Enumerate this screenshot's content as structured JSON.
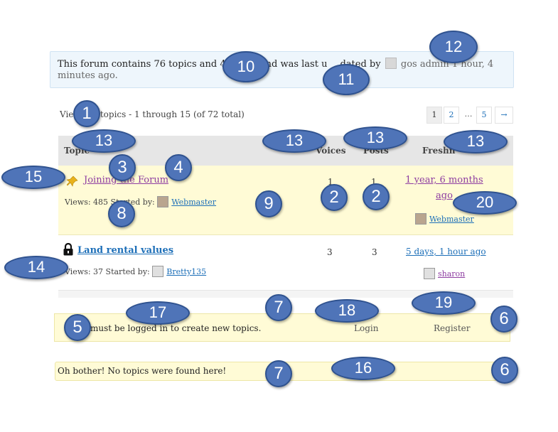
{
  "info": {
    "text_a": "This forum contains 76 topics and 4",
    "text_b": ", and was last u",
    "text_c": "dated by",
    "user": "gos admin",
    "time_a": "1 hour, 4",
    "time_b": "minutes ago."
  },
  "viewing": {
    "text_a": "Vie",
    "text_b": "6 topics - 1 through 15 (of 72 total)"
  },
  "pagination": {
    "pages": [
      "1",
      "2",
      "…",
      "5"
    ],
    "next": "→"
  },
  "table": {
    "headers": {
      "topic": "Topic",
      "voices": "Voices",
      "posts": "Posts",
      "freshness": "Freshn"
    },
    "rows": [
      {
        "title": "Joining the Forum",
        "views": "Views: 485",
        "started_by_label": "Started by:",
        "author": "Webmaster",
        "voices": "1",
        "posts": "1",
        "fresh_a": "1 year, 6 months",
        "fresh_b": "ago",
        "fresh_user": "Webmaster"
      },
      {
        "title": "Land rental values",
        "views": "Views: 37",
        "started_by_label": "Started by:",
        "author": "Bretty135",
        "voices": "3",
        "posts": "3",
        "fresh_a": "5 days, 1 hour ago",
        "fresh_user": "sharon"
      }
    ]
  },
  "notice": {
    "text": "must be logged in to create new topics.",
    "login": "Login",
    "register": "Register"
  },
  "empty": {
    "text": "Oh bother! No topics were found here!"
  },
  "callouts": [
    "1",
    "2",
    "2",
    "3",
    "4",
    "5",
    "6",
    "6",
    "7",
    "7",
    "8",
    "9",
    "10",
    "11",
    "12",
    "13",
    "13",
    "13",
    "13",
    "14",
    "15",
    "16",
    "17",
    "18",
    "19",
    "20"
  ],
  "colors": {
    "badge": "#4f74b8",
    "sticky_row": "#fffbd6",
    "link": "#1d6fb8",
    "visited": "#8e3da1"
  }
}
